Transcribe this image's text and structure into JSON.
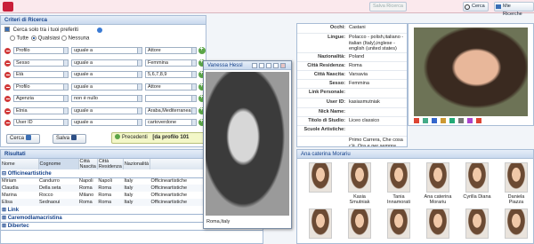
{
  "topbar": {
    "btn_disabled": "Salva Ricerca",
    "btn_search": "Cerca",
    "btn_mine": "Mie Ricerche"
  },
  "criteri": {
    "title": "Criteri di Ricerca",
    "preferiti_label": "Cerca solo tra i tuoi preferiti",
    "radio_all": "Tutte",
    "radio_any": "Qualsiasi",
    "radio_none": "Nessuna",
    "rows": [
      {
        "field": "Profilo",
        "op": "uguale a",
        "value": "Attore"
      },
      {
        "field": "Sesso",
        "op": "uguale a",
        "value": "Femmina"
      },
      {
        "field": "Età",
        "op": "uguale a",
        "value": "5,6,7,8,9"
      },
      {
        "field": "Profilo",
        "op": "uguale a",
        "value": "Attore"
      },
      {
        "field": "Agenzia",
        "op": "non è nullo",
        "value": ""
      },
      {
        "field": "Etnia",
        "op": "uguale a",
        "value": "Araba,Mediterranea,Nord"
      },
      {
        "field": "User ID",
        "op": "uguale a",
        "value": "cartoverdone"
      }
    ],
    "cerca": "Cerca",
    "salva": "Salva",
    "precedenti": "Precedenti",
    "pagination": "[da profilo 101"
  },
  "risultati": {
    "title": "Risultati",
    "columns": [
      "Nome",
      "Cognome",
      "Città Nascita",
      "Città Residenza",
      "Nazionalità"
    ],
    "groups": [
      {
        "name": "Officineartistiche"
      },
      {
        "name": "Link"
      },
      {
        "name": "Caremodlamacristina"
      },
      {
        "name": "Dibertec"
      }
    ],
    "rows": [
      [
        "Miriam",
        "Candurro",
        "Napoli",
        "Napoli",
        "Italy",
        "Officineartistiche"
      ],
      [
        "Claudia",
        "Della seta",
        "Roma",
        "Roma",
        "Italy",
        "Officineartistiche"
      ],
      [
        "Marina",
        "Rocco",
        "Milano",
        "Roma",
        "Italy",
        "Officineartistiche"
      ],
      [
        "Elisa",
        "Sednaoui",
        "Roma",
        "Roma",
        "Italy",
        "Officineartistiche"
      ]
    ]
  },
  "info": {
    "rows": [
      {
        "label": "Occhi:",
        "value": "Castani"
      },
      {
        "label": "Lingue:",
        "value": "Polacco - polish,italiano - italian (Italy),inglese - english (united states)"
      },
      {
        "label": "Nazionalità:",
        "value": "Poland"
      },
      {
        "label": "Città Residenza:",
        "value": "Roma"
      },
      {
        "label": "Città Nascita:",
        "value": "Varsavia"
      },
      {
        "label": "Sesso:",
        "value": "Femmina"
      },
      {
        "label": "Link Personale:",
        "value": ""
      },
      {
        "label": "User ID:",
        "value": "kasiasmutniak"
      },
      {
        "label": "Nick Name:",
        "value": ""
      },
      {
        "label": "Titolo di Studio:",
        "value": "Liceo classico"
      },
      {
        "label": "Scuole Artistiche:",
        "value": ""
      },
      {
        "label": "",
        "value": "Primo Carrera, Che cosa c'è, Ora e per sempre, Tredici a"
      }
    ]
  },
  "popup": {
    "title": "Vanessa Hessl",
    "caption": "Roma,Italy"
  },
  "gallery": {
    "title": "Ana caterina Morariu",
    "thumbs": [
      {
        "name": ""
      },
      {
        "name": "Kasia Smutniak"
      },
      {
        "name": "Tania Innamorati"
      },
      {
        "name": "Ana caterina Morariu"
      },
      {
        "name": "Cyrilla Diana"
      },
      {
        "name": "Daniela Piazza"
      }
    ]
  }
}
